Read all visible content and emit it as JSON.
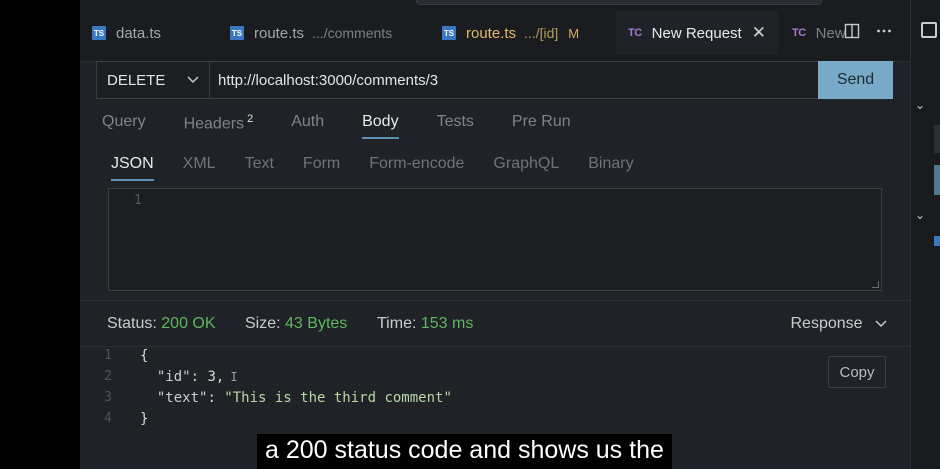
{
  "tabs": [
    {
      "badge": "TS",
      "label": "data.ts",
      "dim": ""
    },
    {
      "badge": "TS",
      "label": "route.ts",
      "dim": ".../comments"
    },
    {
      "badge": "TS",
      "label": "route.ts",
      "dim": ".../[id]",
      "flag": "M"
    },
    {
      "badge": "TC",
      "label": "New Request",
      "close": "✕"
    },
    {
      "badge": "TC",
      "label": "New"
    }
  ],
  "request": {
    "method": "DELETE",
    "url": "http://localhost:3000/comments/3",
    "send_label": "Send"
  },
  "request_tabs": {
    "query": "Query",
    "headers": "Headers",
    "headers_count": "2",
    "auth": "Auth",
    "body": "Body",
    "tests": "Tests",
    "prerun": "Pre Run"
  },
  "body_tabs": [
    "JSON",
    "XML",
    "Text",
    "Form",
    "Form-encode",
    "GraphQL",
    "Binary"
  ],
  "editor": {
    "line1": "1"
  },
  "response": {
    "status_label": "Status:",
    "status_value": "200 OK",
    "size_label": "Size:",
    "size_value": "43 Bytes",
    "time_label": "Time:",
    "time_value": "153 ms",
    "view_label": "Response",
    "copy_label": "Copy",
    "lines": [
      "1",
      "2",
      "3",
      "4"
    ],
    "open_brace": "{",
    "id_key": "\"id\"",
    "id_value": "3",
    "text_key": "\"text\"",
    "text_value": "\"This is the third comment\"",
    "close_brace": "}"
  },
  "caption": "a 200 status code and shows us the"
}
